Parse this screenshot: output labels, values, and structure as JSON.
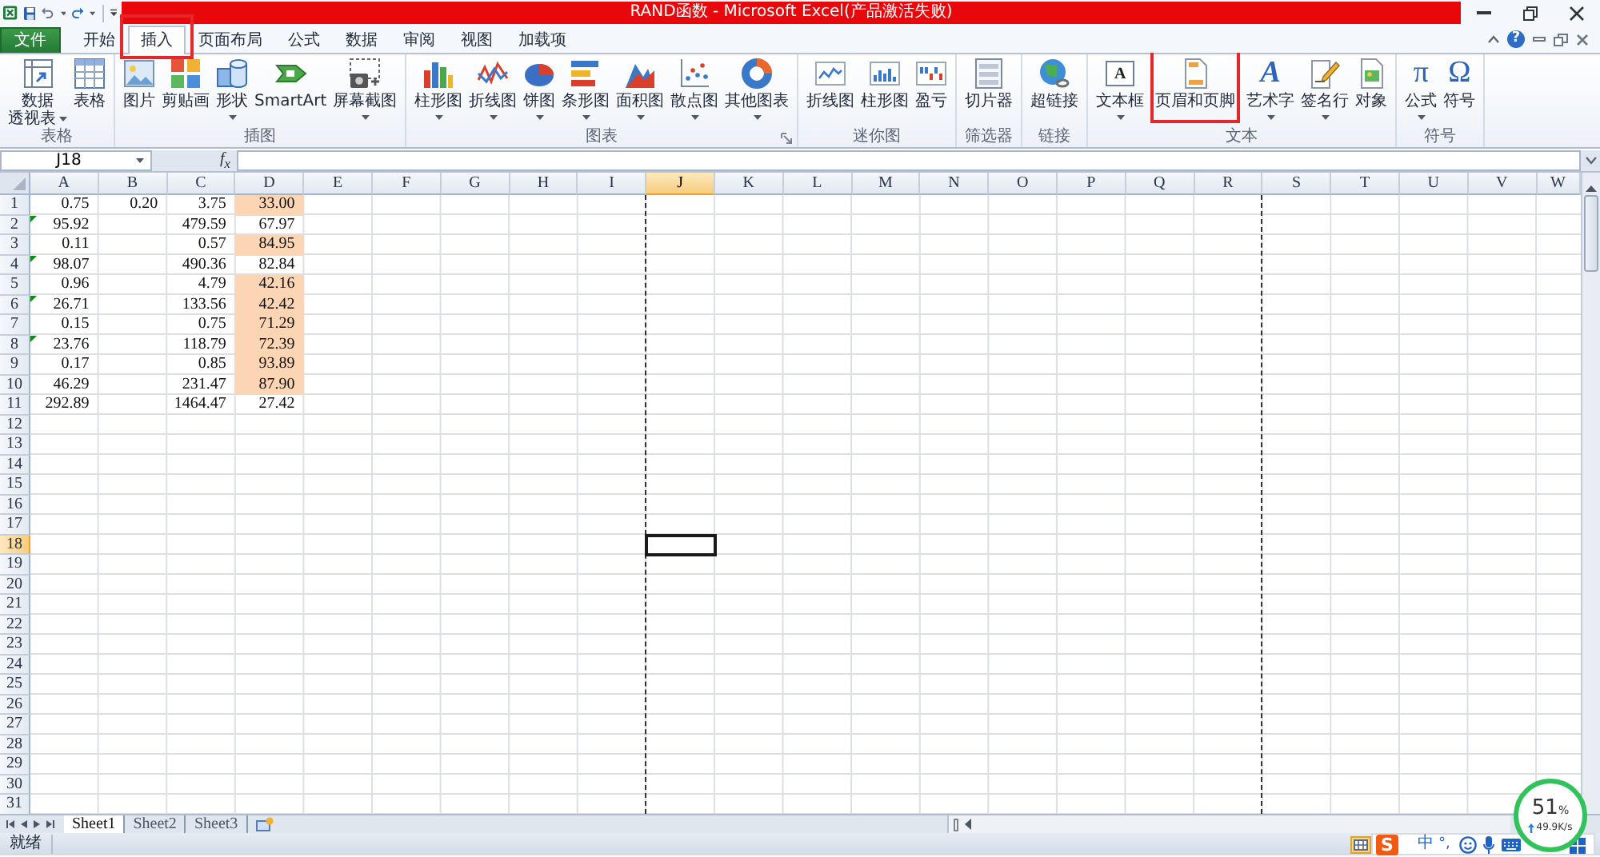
{
  "title_bar": {
    "title": "RAND函数 - Microsoft Excel(产品激活失败)"
  },
  "ribbon_tabs": [
    {
      "label": "文件",
      "kind": "file",
      "selected": false,
      "highlighted": false
    },
    {
      "label": "开始",
      "kind": "tab",
      "selected": false,
      "highlighted": false
    },
    {
      "label": "插入",
      "kind": "tab",
      "selected": true,
      "highlighted": true
    },
    {
      "label": "页面布局",
      "kind": "tab",
      "selected": false,
      "highlighted": false
    },
    {
      "label": "公式",
      "kind": "tab",
      "selected": false,
      "highlighted": false
    },
    {
      "label": "数据",
      "kind": "tab",
      "selected": false,
      "highlighted": false
    },
    {
      "label": "审阅",
      "kind": "tab",
      "selected": false,
      "highlighted": false
    },
    {
      "label": "视图",
      "kind": "tab",
      "selected": false,
      "highlighted": false
    },
    {
      "label": "加载项",
      "kind": "tab",
      "selected": false,
      "highlighted": false
    }
  ],
  "help_button": "?",
  "ribbon_groups": [
    {
      "label": "表格",
      "launcher": false,
      "items": [
        {
          "lines": [
            "数据",
            "透视表"
          ],
          "dropdown": true,
          "highlighted": false
        },
        {
          "lines": [
            "表格"
          ],
          "dropdown": false,
          "highlighted": false
        }
      ]
    },
    {
      "label": "插图",
      "launcher": false,
      "items": [
        {
          "lines": [
            "图片"
          ],
          "dropdown": false,
          "highlighted": false
        },
        {
          "lines": [
            "剪贴画"
          ],
          "dropdown": false,
          "highlighted": false
        },
        {
          "lines": [
            "形状"
          ],
          "dropdown": true,
          "highlighted": false
        },
        {
          "lines": [
            "SmartArt"
          ],
          "dropdown": false,
          "highlighted": false
        },
        {
          "lines": [
            "屏幕截图"
          ],
          "dropdown": true,
          "highlighted": false
        }
      ]
    },
    {
      "label": "图表",
      "launcher": true,
      "items": [
        {
          "lines": [
            "柱形图"
          ],
          "dropdown": true,
          "highlighted": false
        },
        {
          "lines": [
            "折线图"
          ],
          "dropdown": true,
          "highlighted": false
        },
        {
          "lines": [
            "饼图"
          ],
          "dropdown": true,
          "highlighted": false
        },
        {
          "lines": [
            "条形图"
          ],
          "dropdown": true,
          "highlighted": false
        },
        {
          "lines": [
            "面积图"
          ],
          "dropdown": true,
          "highlighted": false
        },
        {
          "lines": [
            "散点图"
          ],
          "dropdown": true,
          "highlighted": false
        },
        {
          "lines": [
            "其他图表"
          ],
          "dropdown": true,
          "highlighted": false
        }
      ]
    },
    {
      "label": "迷你图",
      "launcher": false,
      "items": [
        {
          "lines": [
            "折线图"
          ],
          "dropdown": false,
          "highlighted": false
        },
        {
          "lines": [
            "柱形图"
          ],
          "dropdown": false,
          "highlighted": false
        },
        {
          "lines": [
            "盈亏"
          ],
          "dropdown": false,
          "highlighted": false
        }
      ]
    },
    {
      "label": "筛选器",
      "launcher": false,
      "items": [
        {
          "lines": [
            "切片器"
          ],
          "dropdown": false,
          "highlighted": false
        }
      ]
    },
    {
      "label": "链接",
      "launcher": false,
      "items": [
        {
          "lines": [
            "超链接"
          ],
          "dropdown": false,
          "highlighted": false
        }
      ]
    },
    {
      "label": "文本",
      "launcher": false,
      "items": [
        {
          "lines": [
            "文本框"
          ],
          "glyph": "A",
          "dropdown": true,
          "highlighted": false
        },
        {
          "lines": [
            "页眉和页脚"
          ],
          "dropdown": false,
          "highlighted": true
        },
        {
          "lines": [
            "艺术字"
          ],
          "glyph": "A",
          "dropdown": true,
          "highlighted": false
        },
        {
          "lines": [
            "签名行"
          ],
          "dropdown": true,
          "highlighted": false
        },
        {
          "lines": [
            "对象"
          ],
          "dropdown": false,
          "highlighted": false
        }
      ]
    },
    {
      "label": "符号",
      "launcher": false,
      "items": [
        {
          "lines": [
            "公式"
          ],
          "glyph": "π",
          "dropdown": true,
          "highlighted": false
        },
        {
          "lines": [
            "符号"
          ],
          "glyph": "Ω",
          "dropdown": false,
          "highlighted": false
        }
      ]
    }
  ],
  "formula_bar": {
    "name_box": "J18",
    "function_button": "f$_{x}$"
  },
  "sheet": {
    "columns": [
      {
        "label": "A",
        "selected": false,
        "page_break": false
      },
      {
        "label": "B",
        "selected": false,
        "page_break": false
      },
      {
        "label": "C",
        "selected": false,
        "page_break": false
      },
      {
        "label": "D",
        "selected": false,
        "page_break": false
      },
      {
        "label": "E",
        "selected": false,
        "page_break": false
      },
      {
        "label": "F",
        "selected": false,
        "page_break": false
      },
      {
        "label": "G",
        "selected": false,
        "page_break": false
      },
      {
        "label": "H",
        "selected": false,
        "page_break": false
      },
      {
        "label": "I",
        "selected": false,
        "page_break": false
      },
      {
        "label": "J",
        "selected": true,
        "page_break": true
      },
      {
        "label": "K",
        "selected": false,
        "page_break": false
      },
      {
        "label": "L",
        "selected": false,
        "page_break": false
      },
      {
        "label": "M",
        "selected": false,
        "page_break": false
      },
      {
        "label": "N",
        "selected": false,
        "page_break": false
      },
      {
        "label": "O",
        "selected": false,
        "page_break": false
      },
      {
        "label": "P",
        "selected": false,
        "page_break": false
      },
      {
        "label": "Q",
        "selected": false,
        "page_break": false
      },
      {
        "label": "R",
        "selected": false,
        "page_break": false
      },
      {
        "label": "S",
        "selected": false,
        "page_break": true
      },
      {
        "label": "T",
        "selected": false,
        "page_break": false
      },
      {
        "label": "U",
        "selected": false,
        "page_break": false
      },
      {
        "label": "V",
        "selected": false,
        "page_break": false
      },
      {
        "label": "W",
        "selected": false,
        "page_break": false
      }
    ],
    "rows": [
      {
        "label": "1",
        "selected": false,
        "cells": [
          {
            "value": "0.75",
            "flagged": false,
            "highlighted": false
          },
          {
            "value": "0.20",
            "flagged": false,
            "highlighted": false
          },
          {
            "value": "3.75",
            "flagged": false,
            "highlighted": false
          },
          {
            "value": "33.00",
            "flagged": false,
            "highlighted": true
          }
        ]
      },
      {
        "label": "2",
        "selected": false,
        "cells": [
          {
            "value": "95.92",
            "flagged": true,
            "highlighted": false
          },
          null,
          {
            "value": "479.59",
            "flagged": false,
            "highlighted": false
          },
          {
            "value": "67.97",
            "flagged": false,
            "highlighted": false
          }
        ]
      },
      {
        "label": "3",
        "selected": false,
        "cells": [
          {
            "value": "0.11",
            "flagged": false,
            "highlighted": false
          },
          null,
          {
            "value": "0.57",
            "flagged": false,
            "highlighted": false
          },
          {
            "value": "84.95",
            "flagged": false,
            "highlighted": true
          }
        ]
      },
      {
        "label": "4",
        "selected": false,
        "cells": [
          {
            "value": "98.07",
            "flagged": true,
            "highlighted": false
          },
          null,
          {
            "value": "490.36",
            "flagged": false,
            "highlighted": false
          },
          {
            "value": "82.84",
            "flagged": false,
            "highlighted": false
          }
        ]
      },
      {
        "label": "5",
        "selected": false,
        "cells": [
          {
            "value": "0.96",
            "flagged": false,
            "highlighted": false
          },
          null,
          {
            "value": "4.79",
            "flagged": false,
            "highlighted": false
          },
          {
            "value": "42.16",
            "flagged": false,
            "highlighted": true
          }
        ]
      },
      {
        "label": "6",
        "selected": false,
        "cells": [
          {
            "value": "26.71",
            "flagged": true,
            "highlighted": false
          },
          null,
          {
            "value": "133.56",
            "flagged": false,
            "highlighted": false
          },
          {
            "value": "42.42",
            "flagged": false,
            "highlighted": true
          }
        ]
      },
      {
        "label": "7",
        "selected": false,
        "cells": [
          {
            "value": "0.15",
            "flagged": false,
            "highlighted": false
          },
          null,
          {
            "value": "0.75",
            "flagged": false,
            "highlighted": false
          },
          {
            "value": "71.29",
            "flagged": false,
            "highlighted": true
          }
        ]
      },
      {
        "label": "8",
        "selected": false,
        "cells": [
          {
            "value": "23.76",
            "flagged": true,
            "highlighted": false
          },
          null,
          {
            "value": "118.79",
            "flagged": false,
            "highlighted": false
          },
          {
            "value": "72.39",
            "flagged": false,
            "highlighted": true
          }
        ]
      },
      {
        "label": "9",
        "selected": false,
        "cells": [
          {
            "value": "0.17",
            "flagged": false,
            "highlighted": false
          },
          null,
          {
            "value": "0.85",
            "flagged": false,
            "highlighted": false
          },
          {
            "value": "93.89",
            "flagged": false,
            "highlighted": true
          }
        ]
      },
      {
        "label": "10",
        "selected": false,
        "cells": [
          {
            "value": "46.29",
            "flagged": false,
            "highlighted": false
          },
          null,
          {
            "value": "231.47",
            "flagged": false,
            "highlighted": false
          },
          {
            "value": "87.90",
            "flagged": false,
            "highlighted": true
          }
        ]
      },
      {
        "label": "11",
        "selected": false,
        "cells": [
          {
            "value": "292.89",
            "flagged": false,
            "highlighted": false
          },
          null,
          {
            "value": "1464.47",
            "flagged": false,
            "highlighted": false
          },
          {
            "value": "27.42",
            "flagged": false,
            "highlighted": false
          }
        ]
      },
      {
        "label": "12",
        "selected": false
      },
      {
        "label": "13",
        "selected": false
      },
      {
        "label": "14",
        "selected": false
      },
      {
        "label": "15",
        "selected": false
      },
      {
        "label": "16",
        "selected": false
      },
      {
        "label": "17",
        "selected": false
      },
      {
        "label": "18",
        "selected": true
      },
      {
        "label": "19",
        "selected": false
      },
      {
        "label": "20",
        "selected": false
      },
      {
        "label": "21",
        "selected": false
      },
      {
        "label": "22",
        "selected": false
      },
      {
        "label": "23",
        "selected": false
      },
      {
        "label": "24",
        "selected": false
      },
      {
        "label": "25",
        "selected": false
      },
      {
        "label": "26",
        "selected": false
      },
      {
        "label": "27",
        "selected": false
      },
      {
        "label": "28",
        "selected": false
      },
      {
        "label": "29",
        "selected": false
      },
      {
        "label": "30",
        "selected": false
      },
      {
        "label": "31",
        "selected": false
      }
    ]
  },
  "sheet_tabs": [
    {
      "label": "Sheet1",
      "selected": true
    },
    {
      "label": "Sheet2",
      "selected": false
    },
    {
      "label": "Sheet3",
      "selected": false
    }
  ],
  "status_bar": {
    "text": "就绪",
    "normal_view_selected": true
  },
  "ime_toolbar": {
    "logo": "S",
    "mode": "中",
    "punctuation": "°,"
  },
  "network_widget": {
    "value": "51",
    "unit": "%",
    "speed": "49.9K/s"
  }
}
